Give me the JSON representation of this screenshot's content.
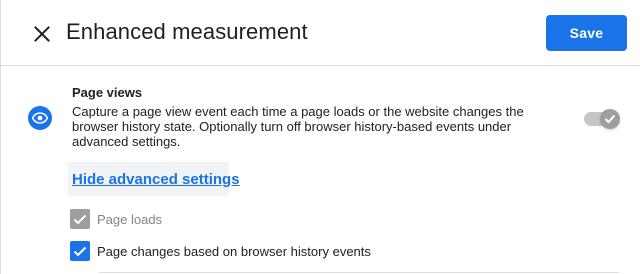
{
  "header": {
    "title": "Enhanced measurement",
    "close_icon": "close-icon",
    "save_label": "Save"
  },
  "page_views": {
    "icon": "eye-icon",
    "title": "Page views",
    "description": "Capture a page view event each time a page loads or the website changes the browser history state. Optionally turn off browser history-based events under advanced settings.",
    "toggle_on": true,
    "toggle_disabled": true,
    "advanced_link": "Hide advanced settings",
    "options": [
      {
        "label": "Page loads",
        "checked": true,
        "disabled": true
      },
      {
        "label": "Page changes based on browser history events",
        "checked": true,
        "disabled": false
      }
    ]
  },
  "colors": {
    "accent": "#1a73e8",
    "disabled": "#9e9e9e",
    "divider": "#dadce0"
  }
}
